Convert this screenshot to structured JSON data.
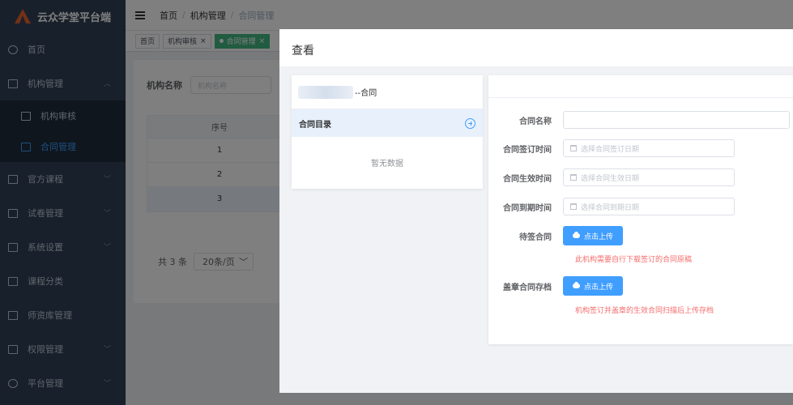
{
  "sidebar": {
    "brand": "云众学堂平台端",
    "items": [
      {
        "label": "首页"
      },
      {
        "label": "机构管理"
      },
      {
        "label": "机构审核"
      },
      {
        "label": "合同管理"
      },
      {
        "label": "官方课程"
      },
      {
        "label": "试卷管理"
      },
      {
        "label": "系统设置"
      },
      {
        "label": "课程分类"
      },
      {
        "label": "师资库管理"
      },
      {
        "label": "权限管理"
      },
      {
        "label": "平台管理"
      }
    ]
  },
  "breadcrumb": [
    "首页",
    "机构管理",
    "合同管理"
  ],
  "tags": [
    {
      "label": "首页"
    },
    {
      "label": "机构审核"
    },
    {
      "label": "合同管理"
    }
  ],
  "main": {
    "filter_label": "机构名称",
    "filter_placeholder": "机构名称",
    "table_header": "序号",
    "rows": [
      "1",
      "2",
      "3"
    ],
    "total": "共 3 条",
    "page_size": "20条/页"
  },
  "dialog": {
    "title": "查看",
    "contract_suffix": "--合同",
    "catalog_label": "合同目录",
    "empty_text": "暂无数据",
    "form": {
      "name_label": "合同名称",
      "sign_label": "合同签订时间",
      "sign_placeholder": "选择合同签订日期",
      "effective_label": "合同生效时间",
      "effective_placeholder": "选择合同生效日期",
      "expire_label": "合同到期时间",
      "expire_placeholder": "选择合同到期日期",
      "pending_label": "待签合同",
      "upload_label": "点击上传",
      "pending_hint": "此机构需要自行下载签订的合同原稿",
      "archive_label": "盖章合同存档",
      "archive_hint": "机构签订并盖章的生效合同扫描后上传存档"
    }
  }
}
